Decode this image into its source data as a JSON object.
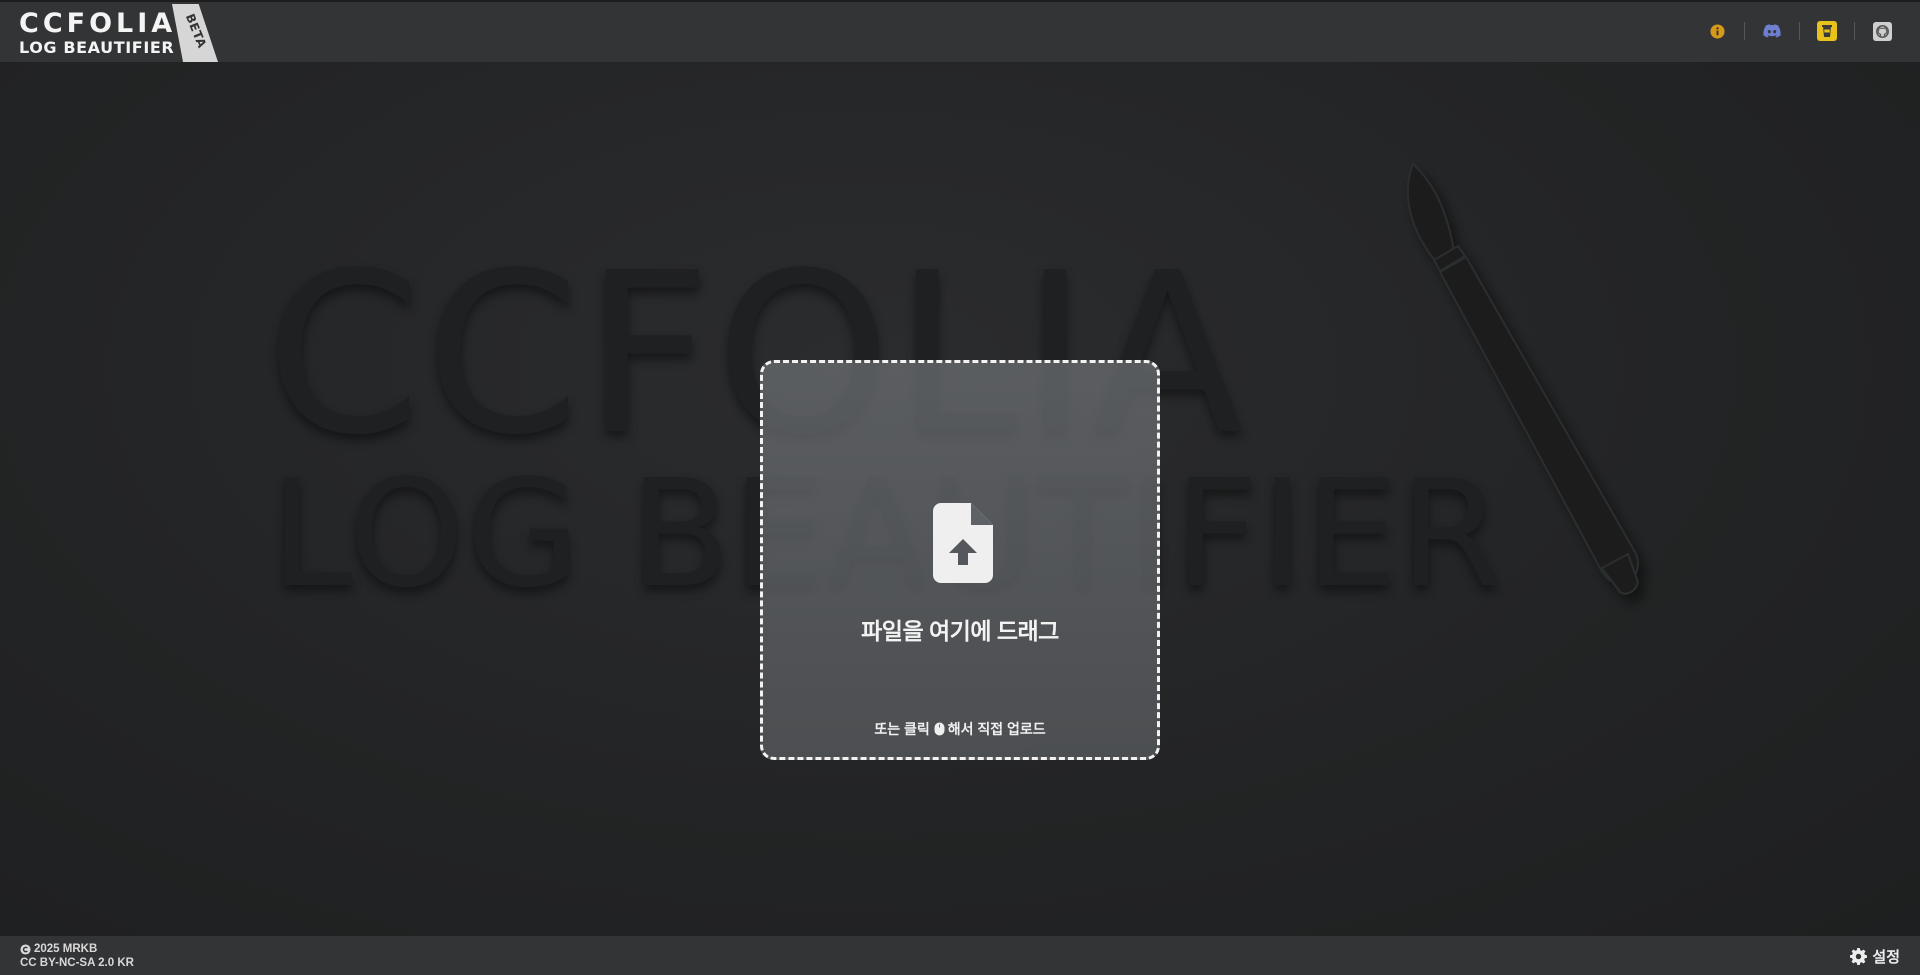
{
  "header": {
    "logo_line1": "CCFOLIA",
    "logo_line2": "LOG BEAUTIFIER",
    "badge": "BETA",
    "icons": [
      "info-icon",
      "discord-icon",
      "coffee-cup-icon",
      "github-icon"
    ]
  },
  "background": {
    "watermark_line1": "CCFOLIA",
    "watermark_line2": "LOG BEAUTIFIER"
  },
  "dropzone": {
    "icon": "file-upload-icon",
    "title": "파일을 여기에 드래그",
    "subtitle_before": "또는 클릭",
    "subtitle_icon": "mouse-icon",
    "subtitle_after": "해서 직접 업로드"
  },
  "footer": {
    "copyright": "2025 MRKB",
    "license": "CC BY-NC-SA 2.0 KR",
    "settings_label": "설정"
  },
  "colors": {
    "topbar_bg": "#333436",
    "body_bg": "#252627",
    "info_icon": "#d69a1b",
    "discord_icon": "#6f7fcf",
    "coffee_icon": "#e8c21a"
  }
}
